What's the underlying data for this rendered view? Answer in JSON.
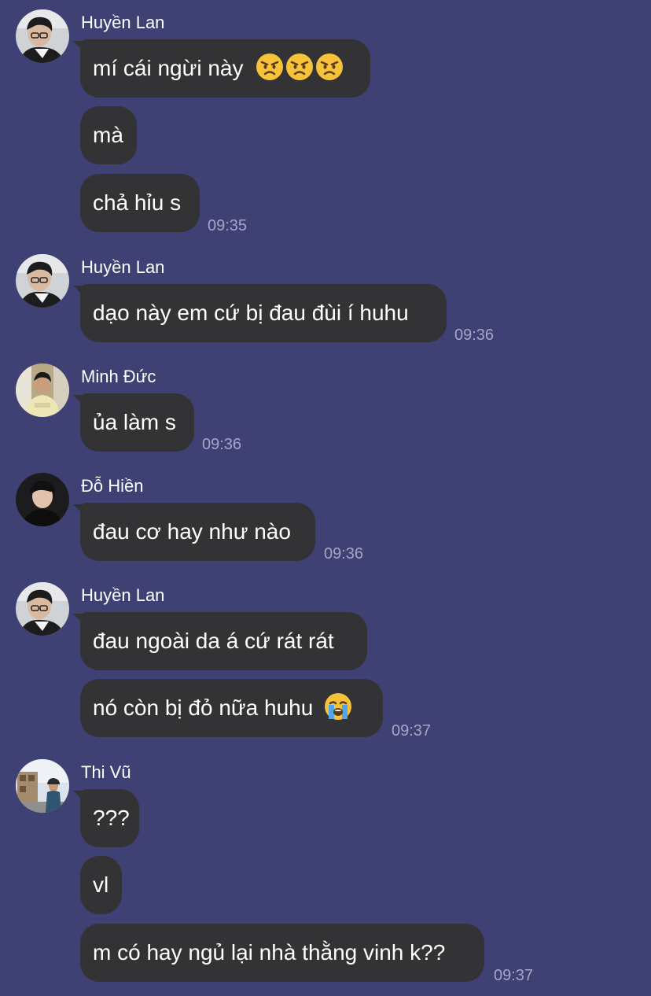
{
  "messages": [
    {
      "sender": "Huyền Lan",
      "bubbles": [
        "mí cái ngừi này",
        "mà",
        "chả hỉu s"
      ],
      "emojis_first": [
        "angry-face",
        "angry-face",
        "angry-face"
      ],
      "time": "09:35"
    },
    {
      "sender": "Huyền Lan",
      "bubbles": [
        "dạo này em cứ bị đau đùi í huhu"
      ],
      "time": "09:36"
    },
    {
      "sender": "Minh Đức",
      "bubbles": [
        "ủa làm s"
      ],
      "time": "09:36"
    },
    {
      "sender": "Đỗ Hiền",
      "bubbles": [
        "đau cơ hay như nào"
      ],
      "time": "09:36"
    },
    {
      "sender": "Huyền Lan",
      "bubbles": [
        "đau ngoài da á cứ rát rát",
        "nó còn bị đỏ nữa huhu"
      ],
      "emojis_last": [
        "loudly-crying-face"
      ],
      "time": "09:37"
    },
    {
      "sender": "Thi Vũ",
      "bubbles": [
        "???",
        "vl",
        "m có hay ngủ lại nhà thằng vinh k??"
      ],
      "time": "09:37"
    }
  ],
  "colors": {
    "background": "#3f4175",
    "bubble": "#333336",
    "text": "#ffffff",
    "timestamp": "#a4a6c6"
  }
}
